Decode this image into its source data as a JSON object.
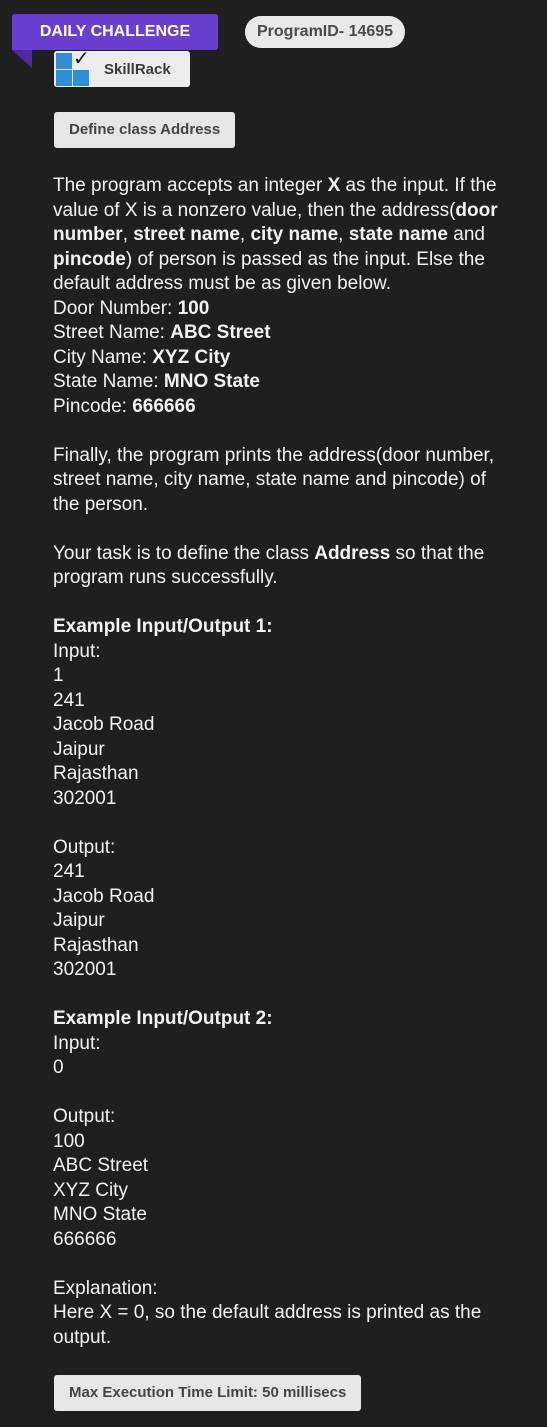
{
  "header": {
    "badge_label": "DAILY CHALLENGE",
    "program_id": "ProgramID- 14695",
    "brand_name": "SkillRack",
    "problem_title": "Define class Address"
  },
  "description": {
    "p1_a": "The program accepts an integer ",
    "p1_b": "X",
    "p1_c": " as the input. If the",
    "p1_d": "value of X is a nonzero value, then the address(",
    "p1_e": "door",
    "p1_f": "number",
    "p1_g": ", ",
    "p1_h": "street name",
    "p1_i": ", ",
    "p1_j": "city name",
    "p1_k": ", ",
    "p1_l": "state name",
    "p1_m": " and",
    "p1_n": "pincode",
    "p1_o": ") of person is passed as the input. Else the",
    "p1_p": "default address must be as given below.",
    "defaults": [
      {
        "label": "Door Number: ",
        "value": "100"
      },
      {
        "label": "Street Name: ",
        "value": "ABC Street"
      },
      {
        "label": "City Name: ",
        "value": "XYZ City"
      },
      {
        "label": "State Name: ",
        "value": "MNO State"
      },
      {
        "label": "Pincode: ",
        "value": "666666"
      }
    ],
    "p2_l1": "Finally, the program prints the address(door number,",
    "p2_l2": "street name, city name, state name and pincode) of",
    "p2_l3": "the person.",
    "p3_a": "Your task is to define the class ",
    "p3_b": "Address",
    "p3_c": " so that the",
    "p3_d": "program runs successfully."
  },
  "examples": [
    {
      "heading": "Example Input/Output 1:",
      "input_label": "Input:",
      "input_lines": [
        "1",
        "241",
        "Jacob Road",
        "Jaipur",
        "Rajasthan",
        "302001"
      ],
      "output_label": "Output:",
      "output_lines": [
        "241",
        "Jacob Road",
        "Jaipur",
        "Rajasthan",
        "302001"
      ]
    },
    {
      "heading": "Example Input/Output 2:",
      "input_label": "Input:",
      "input_lines": [
        "0"
      ],
      "output_label": "Output:",
      "output_lines": [
        "100",
        "ABC Street",
        "XYZ City",
        "MNO State",
        "666666"
      ],
      "explanation_label": "Explanation:",
      "explanation_l1": "Here X = 0, so the default address is printed as the",
      "explanation_l2": "output."
    }
  ],
  "footer": {
    "time_limit": "Max Execution Time Limit: 50 millisecs"
  },
  "colors": {
    "background": "#1f1f1f",
    "ribbon": "#6a3fd0",
    "logo_blue": "#2e8fd6"
  }
}
